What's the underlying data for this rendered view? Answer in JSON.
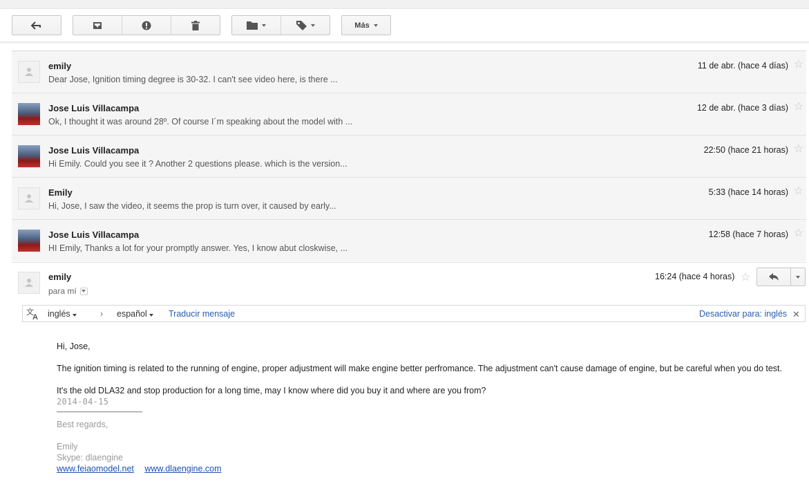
{
  "toolbar": {
    "back_icon": "arrow-left-icon",
    "archive_icon": "archive-icon",
    "spam_icon": "report-spam-icon",
    "delete_icon": "trash-icon",
    "move_icon": "folder-icon",
    "label_icon": "tag-icon",
    "more_label": "Más"
  },
  "thread": {
    "messages": [
      {
        "sender": "emily",
        "snippet": "Dear Jose, Ignition timing degree is 30-32. I can't see video here, is there ...",
        "date": "11 de abr. (hace 4 días)",
        "avatar": "default"
      },
      {
        "sender": "Jose Luis Villacampa",
        "snippet": "Ok, I thought it was around 28º. Of course I´m speaking about the model with ...",
        "date": "12 de abr. (hace 3 días)",
        "avatar": "photo"
      },
      {
        "sender": "Jose Luis Villacampa",
        "snippet": "Hi Emily. Could you see it ? Another 2 questions please. which is the version...",
        "date": "22:50 (hace 21 horas)",
        "avatar": "photo"
      },
      {
        "sender": "Emily",
        "snippet": "Hi, Jose, I saw the video, it seems the prop is turn over, it caused by early...",
        "date": "5:33 (hace 14 horas)",
        "avatar": "default"
      },
      {
        "sender": "Jose Luis Villacampa",
        "snippet": "HI Emily, Thanks a lot for your promptly answer. Yes, I know abut closkwise, ...",
        "date": "12:58 (hace 7 horas)",
        "avatar": "photo"
      }
    ]
  },
  "expanded": {
    "sender": "emily",
    "to": "para mí",
    "date": "16:24 (hace 4 horas)",
    "translate": {
      "from": "inglés",
      "to": "español",
      "action": "Traducir mensaje",
      "disable": "Desactivar para: inglés"
    },
    "body": {
      "greeting": "Hi, Jose,",
      "para1": "The ignition timing is related to the running of engine,  proper adjustment will make engine better perfromance. The adjustment can't cause damage of engine, but be careful when you do test.",
      "para2": "It's the old DLA32 and stop production for a long time, may I know where did you buy it and where are you from?",
      "sig_date": "2014-04-15",
      "regards": "Best regards,",
      "name": "Emily",
      "skype": "Skype: dlaengine",
      "link1": "www.feiaomodel.net",
      "link2": "www.dlaengine.com"
    }
  },
  "colors": {
    "link": "#1a4fb3",
    "row_bg": "#f5f5f5",
    "grey_text": "#9a9a9a"
  }
}
